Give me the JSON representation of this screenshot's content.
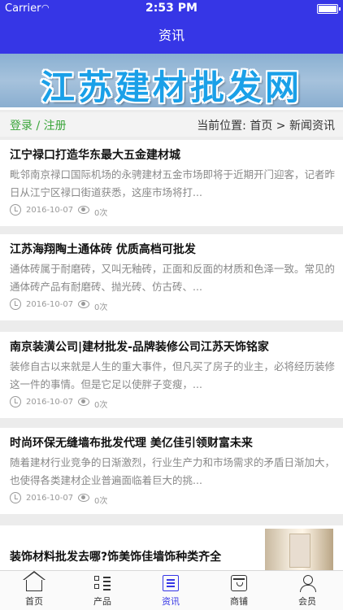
{
  "status_bar": {
    "carrier": "Carrier",
    "time": "2:53 PM"
  },
  "nav": {
    "title": "资讯"
  },
  "banner": {
    "text": "江苏建材批发网"
  },
  "location_bar": {
    "login_text": "登录 / 注册",
    "location_text": "当前位置:  首页 > 新闻资讯"
  },
  "news": [
    {
      "title": "江宁禄口打造华东最大五金建材城",
      "summary": "毗邻南京禄口国际机场的永骋建材五金市场即将于近期开门迎客，记者昨日从江宁区禄口街道获悉，这座市场将打...",
      "date": "2016-10-07",
      "views": "0次"
    },
    {
      "title": "江苏海翔陶土通体砖 优质高档可批发",
      "summary": "通体砖属于耐磨砖，又叫无釉砖，正面和反面的材质和色泽一致。常见的通体砖产品有耐磨砖、抛光砖、仿古砖、...",
      "date": "2016-10-07",
      "views": "0次"
    },
    {
      "title": "南京装潢公司|建材批发-品牌装修公司江苏天饰铭家",
      "summary": "装修自古以来就是人生的重大事件，但凡买了房子的业主，必将经历装修这一件的事情。但是它足以使胖子变瘦，...",
      "date": "2016-10-07",
      "views": "0次"
    },
    {
      "title": "时尚环保无缝墙布批发代理 美亿佳引领财富未来",
      "summary": "随着建材行业竞争的日渐激烈，行业生产力和市场需求的矛盾日渐加大，也使得各类建材企业普遍面临着巨大的挑...",
      "date": "2016-10-07",
      "views": "0次"
    },
    {
      "title": "装饰材料批发去哪?饰美饰佳墙饰种类齐全"
    }
  ],
  "tabbar": {
    "items": [
      {
        "label": "首页",
        "icon": "home-icon"
      },
      {
        "label": "产品",
        "icon": "products-icon"
      },
      {
        "label": "资讯",
        "icon": "news-icon",
        "active": true
      },
      {
        "label": "商铺",
        "icon": "shop-icon"
      },
      {
        "label": "会员",
        "icon": "member-icon"
      }
    ]
  },
  "colors": {
    "primary": "#3636e6",
    "login_green": "#3aa53a",
    "banner_text": "#1aa0e8"
  }
}
